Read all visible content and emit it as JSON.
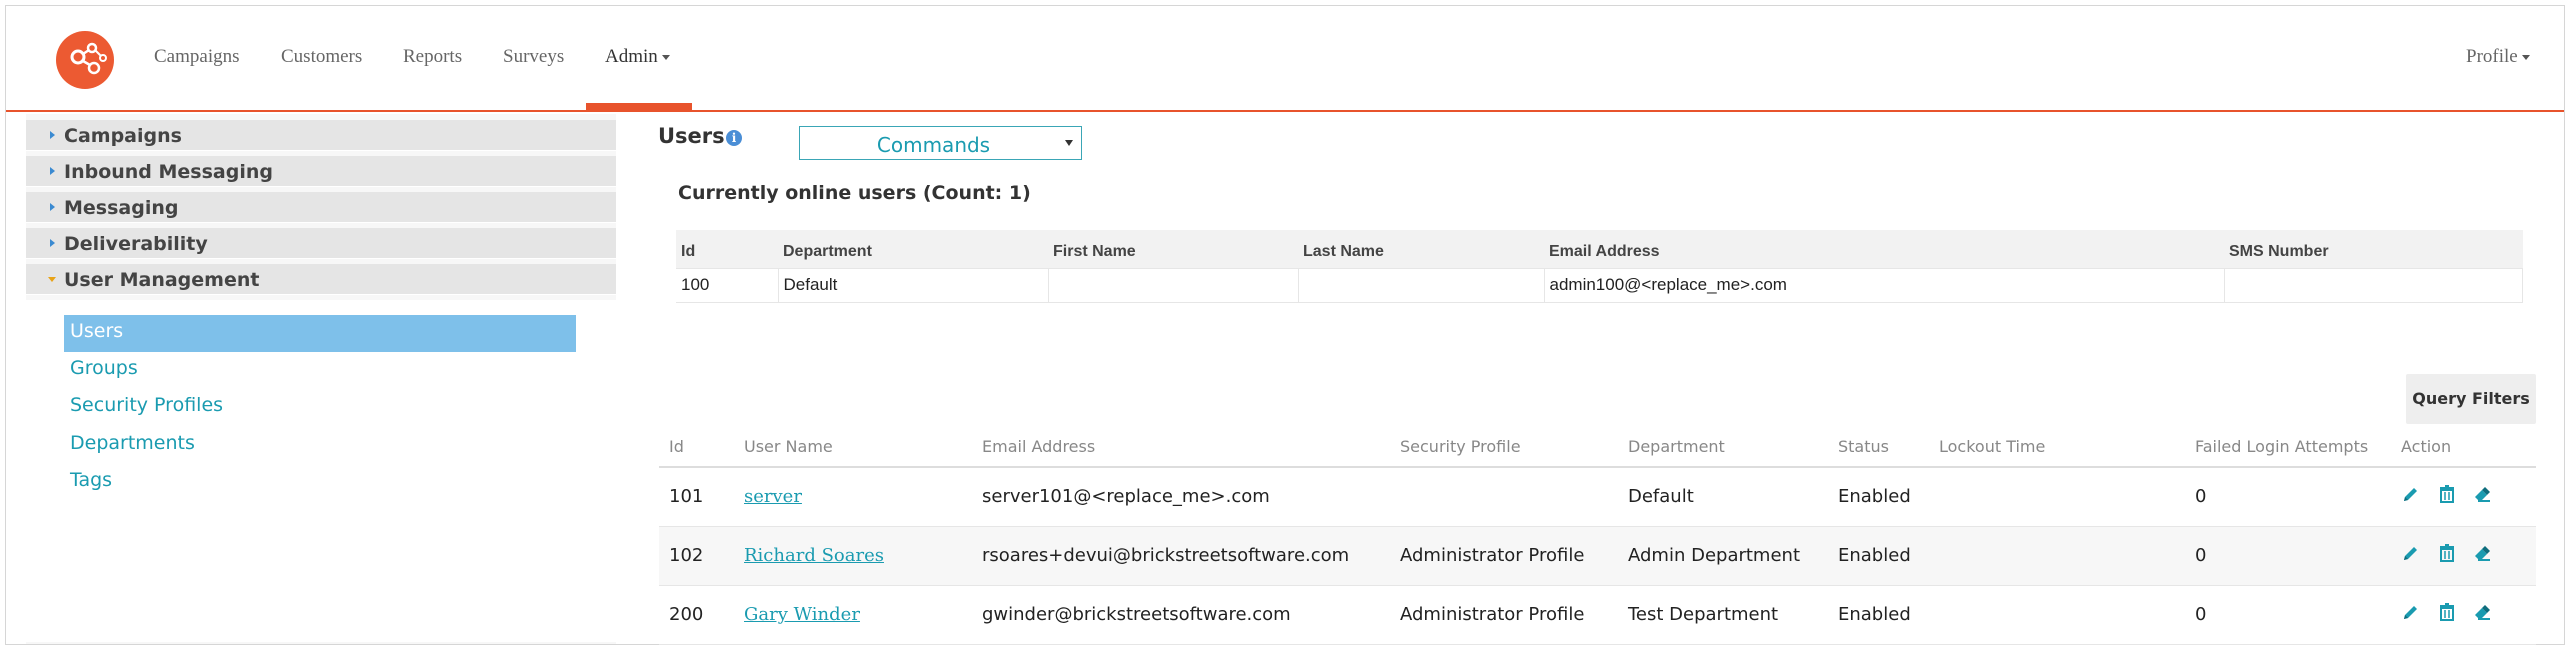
{
  "nav": {
    "items": [
      {
        "label": "Campaigns"
      },
      {
        "label": "Customers"
      },
      {
        "label": "Reports"
      },
      {
        "label": "Surveys"
      },
      {
        "label": "Admin"
      }
    ],
    "active": "Admin",
    "profile_label": "Profile"
  },
  "colors": {
    "accent": "#e8532c",
    "link": "#1a9bb0",
    "selected_bg": "#7ec0ea"
  },
  "sidebar": {
    "sections": [
      {
        "label": "Campaigns",
        "expanded": false
      },
      {
        "label": "Inbound Messaging",
        "expanded": false
      },
      {
        "label": "Messaging",
        "expanded": false
      },
      {
        "label": "Deliverability",
        "expanded": false
      },
      {
        "label": "User Management",
        "expanded": true
      }
    ],
    "subitems": [
      {
        "label": "Users",
        "selected": true
      },
      {
        "label": "Groups",
        "selected": false
      },
      {
        "label": "Security Profiles",
        "selected": false
      },
      {
        "label": "Departments",
        "selected": false
      },
      {
        "label": "Tags",
        "selected": false
      }
    ]
  },
  "main": {
    "title": "Users",
    "info_icon": "info-icon",
    "commands_label": "Commands",
    "online_title": "Currently online users (Count: 1)",
    "online_table": {
      "headers": [
        "Id",
        "Department",
        "First Name",
        "Last Name",
        "Email Address",
        "SMS Number"
      ],
      "rows": [
        [
          "100",
          "Default",
          "",
          "",
          "admin100@<replace_me>.com",
          ""
        ]
      ]
    },
    "query_filters_label": "Query Filters",
    "users_table": {
      "headers": [
        "Id",
        "User Name",
        "Email Address",
        "Security Profile",
        "Department",
        "Status",
        "Lockout Time",
        "Failed Login Attempts",
        "Action"
      ],
      "rows": [
        {
          "id": "101",
          "username": "server",
          "email": "server101@<replace_me>.com",
          "security_profile": "",
          "department": "Default",
          "status": "Enabled",
          "lockout_time": "",
          "failed_attempts": "0"
        },
        {
          "id": "102",
          "username": "Richard Soares",
          "email": "rsoares+devui@brickstreetsoftware.com",
          "security_profile": "Administrator Profile",
          "department": "Admin Department",
          "status": "Enabled",
          "lockout_time": "",
          "failed_attempts": "0"
        },
        {
          "id": "200",
          "username": "Gary Winder",
          "email": "gwinder@brickstreetsoftware.com",
          "security_profile": "Administrator Profile",
          "department": "Test Department",
          "status": "Enabled",
          "lockout_time": "",
          "failed_attempts": "0"
        }
      ],
      "action_icons": [
        "edit-icon",
        "delete-icon",
        "unlock-icon"
      ]
    }
  }
}
